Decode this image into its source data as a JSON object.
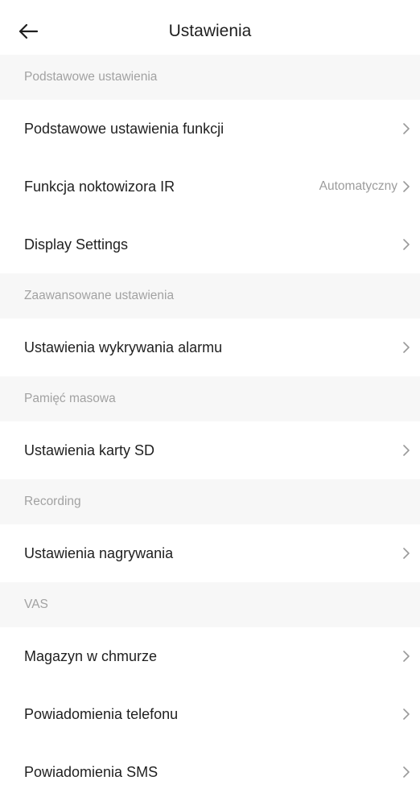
{
  "header": {
    "title": "Ustawienia",
    "back_icon": "arrow-left-icon"
  },
  "sections": [
    {
      "header": "Podstawowe ustawienia",
      "items": [
        {
          "label": "Podstawowe ustawienia funkcji",
          "value": ""
        },
        {
          "label": "Funkcja noktowizora IR",
          "value": "Automatyczny"
        },
        {
          "label": "Display Settings",
          "value": ""
        }
      ]
    },
    {
      "header": "Zaawansowane ustawienia",
      "items": [
        {
          "label": "Ustawienia wykrywania alarmu",
          "value": ""
        }
      ]
    },
    {
      "header": "Pamięć masowa",
      "items": [
        {
          "label": "Ustawienia karty SD",
          "value": ""
        }
      ]
    },
    {
      "header": "Recording",
      "items": [
        {
          "label": "Ustawienia nagrywania",
          "value": ""
        }
      ]
    },
    {
      "header": "VAS",
      "items": [
        {
          "label": "Magazyn w chmurze",
          "value": ""
        },
        {
          "label": "Powiadomienia telefonu",
          "value": ""
        },
        {
          "label": "Powiadomienia SMS",
          "value": ""
        }
      ]
    }
  ],
  "colors": {
    "background": "#ffffff",
    "section_background": "#f7f7f7",
    "section_text": "#a2a2a2",
    "primary_text": "#1f1f1f",
    "secondary_text": "#9c9c9c",
    "chevron": "#9a9a9a"
  },
  "icons": {
    "row_chevron": "chevron-right-icon"
  }
}
